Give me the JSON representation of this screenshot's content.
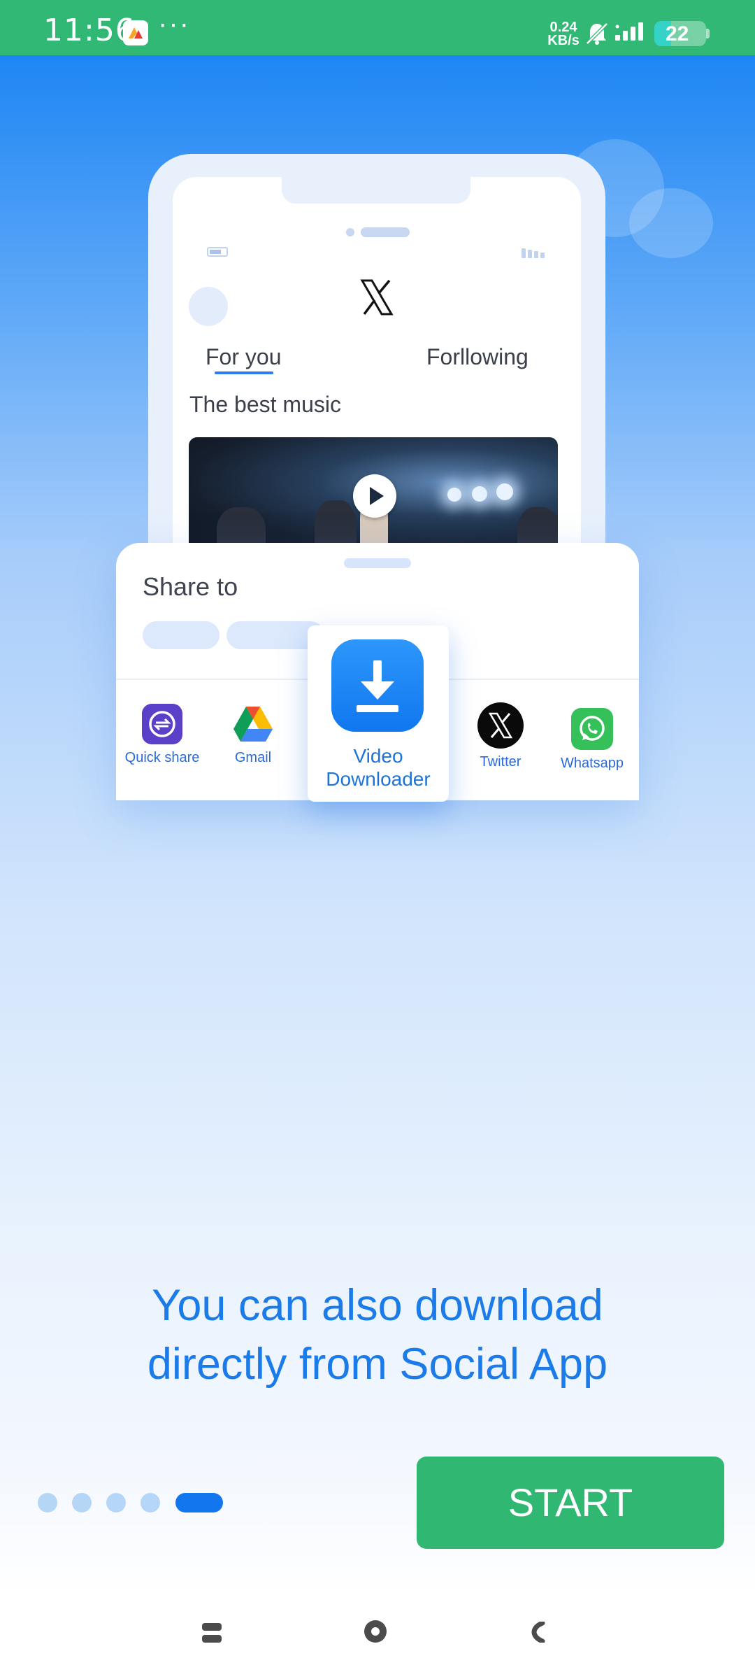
{
  "status_bar": {
    "time": "11:56",
    "more_indicator": "···",
    "net_speed_value": "0.24",
    "net_speed_unit": "KB/s",
    "battery_level": "22",
    "icons": [
      "app-notification-icon",
      "bell-muted-icon",
      "signal-icon",
      "battery-icon"
    ]
  },
  "illustration": {
    "platform_logo": "X",
    "tabs": [
      "For you",
      "Forllowing"
    ],
    "post_title": "The best music",
    "share_sheet": {
      "title": "Share to",
      "apps": [
        {
          "label": "Quick share",
          "icon": "quick-share-icon"
        },
        {
          "label": "Gmail",
          "icon": "google-drive-icon"
        },
        {
          "label": "Video Downloader",
          "icon": "download-icon"
        },
        {
          "label": "Twitter",
          "icon": "x-logo-icon"
        },
        {
          "label": "Whatsapp",
          "icon": "whatsapp-icon"
        }
      ]
    }
  },
  "onboarding": {
    "headline_line1": "You can also download",
    "headline_line2": "directly from Social App",
    "page_count": 5,
    "current_page": 5,
    "start_label": "START"
  },
  "colors": {
    "status_bar": "#31b875",
    "accent_blue": "#1b7be8",
    "start_button": "#30b873"
  }
}
